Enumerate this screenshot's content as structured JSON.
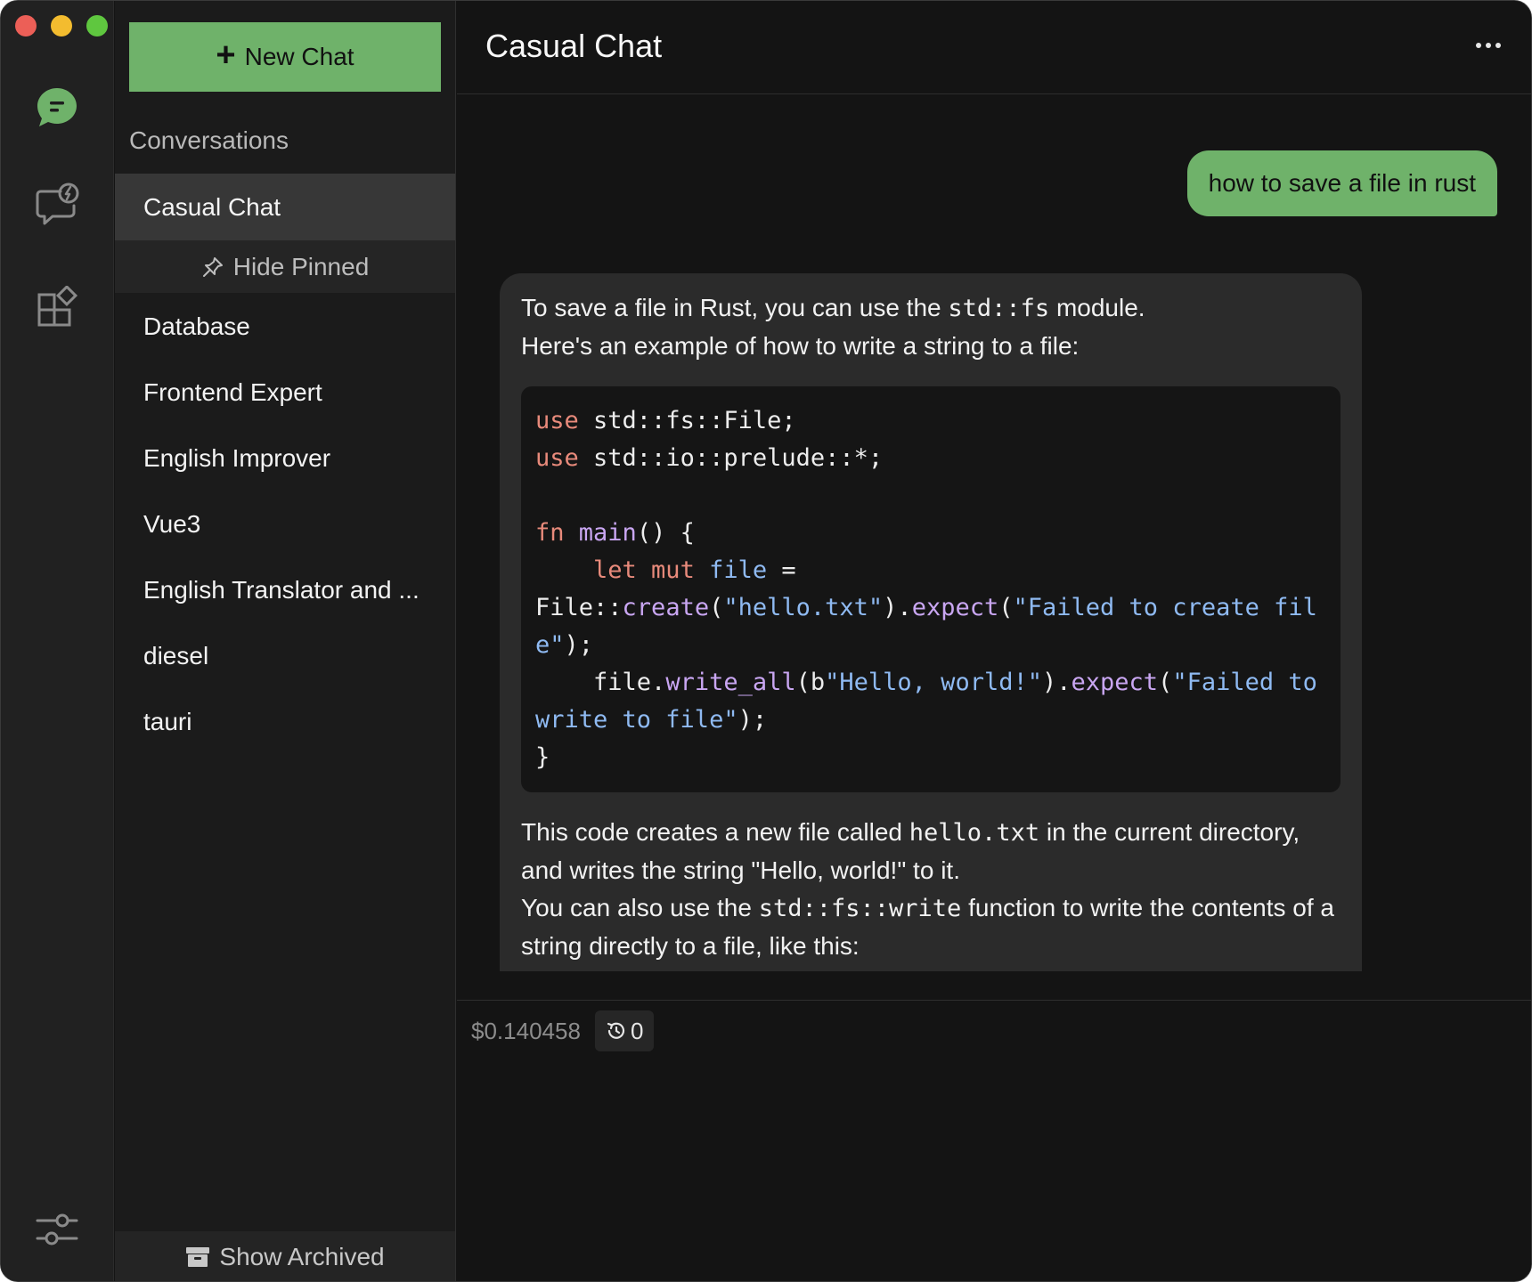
{
  "window": {
    "controls": [
      "close",
      "minimize",
      "zoom"
    ]
  },
  "rail": {
    "icons": [
      "chat-bubble-icon",
      "prompt-bubble-icon",
      "extensions-icon",
      "settings-sliders-icon"
    ]
  },
  "sidebar": {
    "new_chat_label": "New Chat",
    "section_title": "Conversations",
    "active_conversation": "Casual Chat",
    "hide_pinned_label": "Hide Pinned",
    "conversations": [
      "Database",
      "Frontend Expert",
      "English Improver",
      "Vue3",
      "English Translator and ...",
      "diesel",
      "tauri"
    ],
    "show_archived_label": "Show Archived"
  },
  "header": {
    "title": "Casual Chat"
  },
  "chat": {
    "user_message": "how to save a file in rust",
    "assistant": {
      "p1_a": "To save a file in Rust, you can use the ",
      "p1_code": "std::fs",
      "p1_b": " module.",
      "p2": "Here's an example of how to write a string to a file:",
      "code": {
        "l1_kw": "use",
        "l1_rest": " std::fs::File;",
        "l2_kw": "use",
        "l2_rest": " std::io::prelude::*;",
        "l4_kw": "fn",
        "l4_fn": "main",
        "l4_rest": "() {",
        "l5_indent": "    ",
        "l5_kw": "let mut",
        "l5_var": "file",
        "l5_eq": " =",
        "l6_a": "File::",
        "l6_m1": "create",
        "l6_p1": "(",
        "l6_s1": "\"hello.txt\"",
        "l6_p2": ").",
        "l6_m2": "expect",
        "l6_p3": "(",
        "l6_s2": "\"Failed to create file\"",
        "l6_end": ");",
        "l7_a": "    file.",
        "l7_m1": "write_all",
        "l7_p1": "(b",
        "l7_s1": "\"Hello, world!\"",
        "l7_p2": ").",
        "l7_m2": "expect",
        "l7_p3": "(",
        "l7_s2": "\"Failed to write to file\"",
        "l7_end": ");",
        "l8": "}"
      },
      "p3_a": "This code creates a new file called ",
      "p3_code": "hello.txt",
      "p3_b": " in the current directory, and writes the string \"Hello, world!\" to it.",
      "p4_a": "You can also use the ",
      "p4_code": "std::fs::write",
      "p4_b": " function to write the contents of a string directly to a file, like this:"
    }
  },
  "footer": {
    "cost": "$0.140458",
    "history_count": "0"
  },
  "colors": {
    "accent_green": "#6fb26a",
    "window_bg": "#141414",
    "sidebar_bg": "#1b1b1b",
    "active_item_bg": "#373737",
    "assistant_bubble_bg": "#2b2b2b",
    "code_bg": "#151515",
    "keyword": "#e88a7b",
    "function": "#c9a6f2",
    "string": "#8fbaf2"
  }
}
